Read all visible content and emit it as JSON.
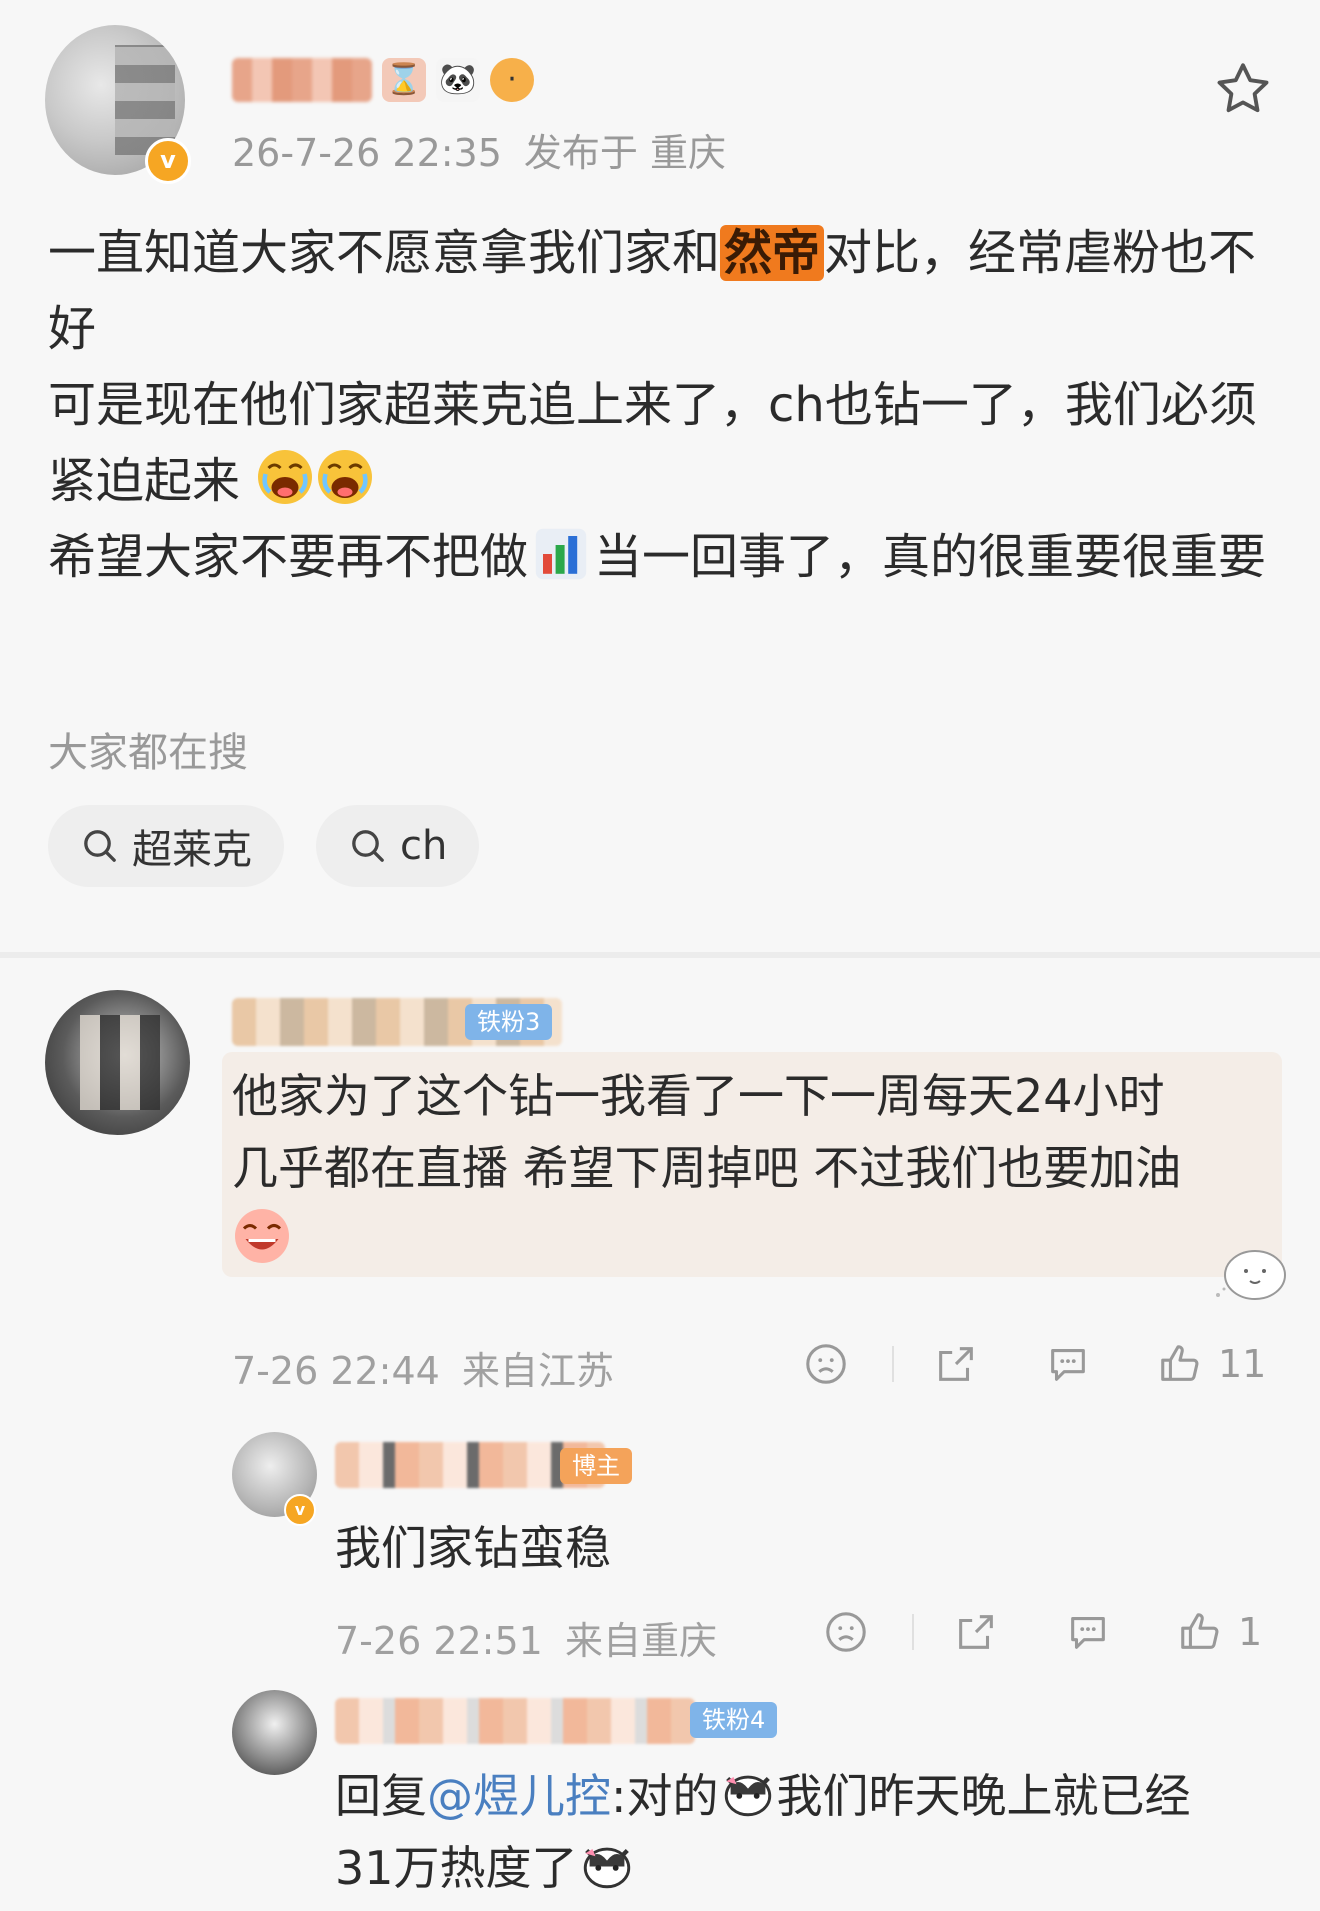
{
  "post": {
    "author_name_hidden": "",
    "timestamp": "26-7-26 22:35",
    "location": "发布于 重庆",
    "paragraphs": [
      {
        "before": "一直知道大家不愿意拿我们家和",
        "highlight": "然帝",
        "after": "对比，经常虐粉也不好"
      },
      {
        "text": "可是现在他们家超莱克追上来了，ch也钻一了，我们必须紧迫起来"
      },
      {
        "before": "希望大家不要再不把做",
        "after": "当一回事了，真的很重要很重要"
      }
    ],
    "search_title": "大家都在搜",
    "search_chips": [
      "超莱克",
      "ch"
    ]
  },
  "comments": [
    {
      "fan_badge": "铁粉3",
      "text_line1": "他家为了这个钻一我看了一下一周每天24小时",
      "text_line2": "几乎都在直播 希望下周掉吧 不过我们也要加油",
      "time": "7-26 22:44",
      "location": "来自江苏",
      "likes": "11"
    }
  ],
  "replies": [
    {
      "role_badge": "博主",
      "text": "我们家钻蛮稳",
      "time": "7-26 22:51",
      "location": "来自重庆",
      "likes": "1"
    },
    {
      "fan_badge": "铁粉4",
      "prefix": "回复",
      "mention": "@煜儿控",
      "text_a": ":对的",
      "text_b": "我们昨天晚上就已经",
      "text_c": "31万热度了"
    }
  ],
  "colors": {
    "highlight": "#f07a1e",
    "mention": "#4a7fc0",
    "fan_badge": "#7fb4e9",
    "verified": "#f6a623"
  }
}
